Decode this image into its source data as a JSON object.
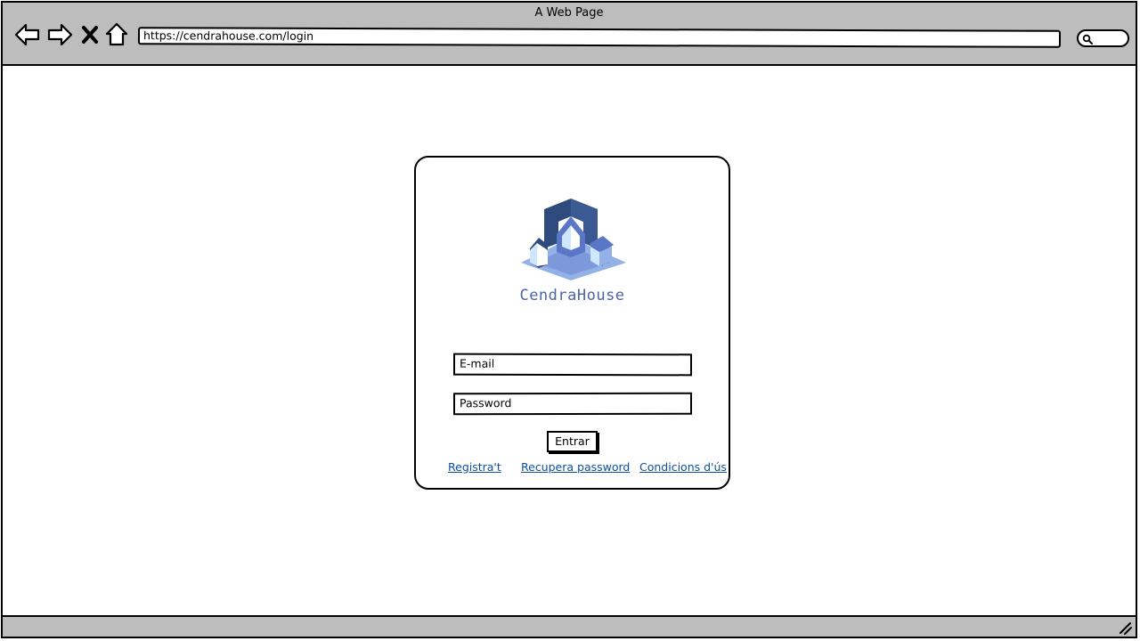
{
  "window": {
    "title": "A Web Page"
  },
  "toolbar": {
    "url": "https://cendrahouse.com/login",
    "icons": [
      "back-icon",
      "forward-icon",
      "close-icon",
      "home-icon",
      "search-icon"
    ]
  },
  "brand": {
    "name": "CendraHouse",
    "colors": {
      "dark": "#2f4a7c",
      "mid": "#5a76c6",
      "light": "#93b1e6",
      "pale": "#cfe6ff",
      "text": "#4a66a6"
    }
  },
  "login": {
    "email_placeholder": "E-mail",
    "password_placeholder": "Password",
    "submit_label": "Entrar"
  },
  "links": {
    "register": "Registra't",
    "recover": "Recupera password",
    "terms": "Condicions d'ús"
  },
  "colors": {
    "chrome": "#bdbdbd",
    "link": "#0b4f9e"
  }
}
